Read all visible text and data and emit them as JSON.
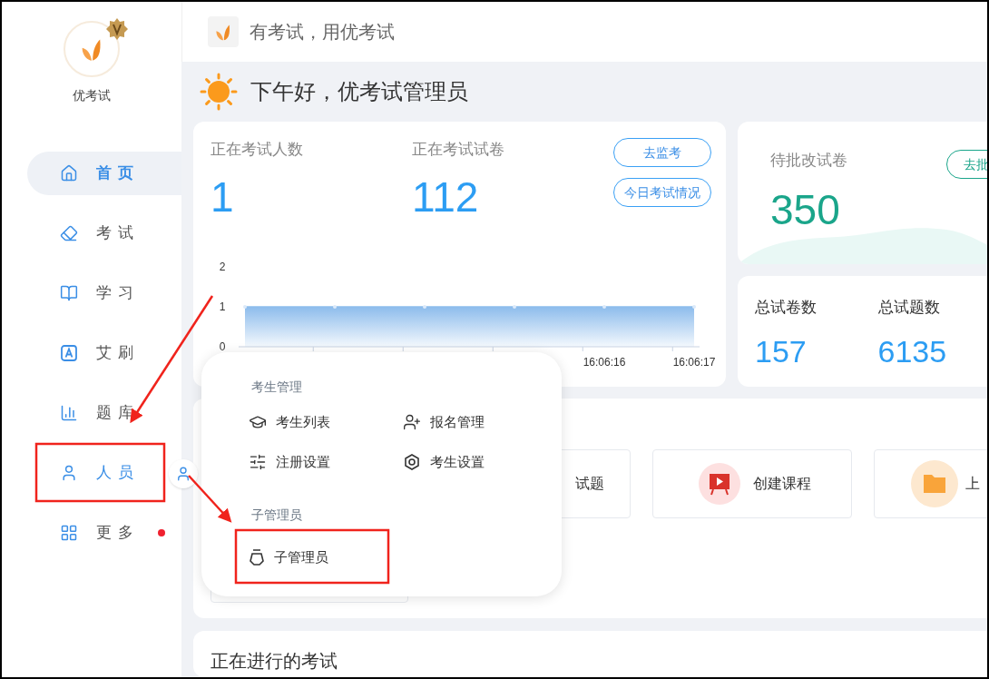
{
  "header": {
    "title": "有考试，用优考试"
  },
  "sidebar": {
    "brand": "优考试",
    "items": [
      {
        "label": "首页",
        "kind": "home",
        "selected": true,
        "expanded": false,
        "dot": false
      },
      {
        "label": "考试",
        "kind": "exam",
        "selected": false,
        "expanded": false,
        "dot": false
      },
      {
        "label": "学习",
        "kind": "study",
        "selected": false,
        "expanded": false,
        "dot": false
      },
      {
        "label": "艾刷",
        "kind": "practice",
        "selected": false,
        "expanded": false,
        "dot": false
      },
      {
        "label": "题库",
        "kind": "bank",
        "selected": false,
        "expanded": false,
        "dot": false
      },
      {
        "label": "人员",
        "kind": "people",
        "selected": false,
        "expanded": true,
        "dot": false
      },
      {
        "label": "更多",
        "kind": "more",
        "selected": false,
        "expanded": false,
        "dot": true
      }
    ]
  },
  "greeting": "下午好，优考试管理员",
  "live_card": {
    "stats": [
      {
        "label": "正在考试人数",
        "value": "1"
      },
      {
        "label": "正在考试试卷",
        "value": "112"
      }
    ],
    "buttons": [
      "去监考",
      "今日考试情况"
    ],
    "chart_data": {
      "type": "area",
      "categories": [
        null,
        null,
        null,
        null,
        "16:06:16",
        "16:06:17"
      ],
      "series": [
        {
          "color": "#8dbcec",
          "values": [
            1,
            1,
            1,
            1,
            1,
            1
          ]
        }
      ],
      "ylim": [
        0,
        2
      ],
      "yticks": [
        0,
        1,
        2
      ]
    }
  },
  "review_card": {
    "label": "待批改试卷",
    "value": "350",
    "button": "去批"
  },
  "totals_card": {
    "stats": [
      {
        "label": "总试卷数",
        "value": "157"
      },
      {
        "label": "总试题数",
        "value": "6135"
      }
    ]
  },
  "quick_actions": [
    {
      "label": "试题",
      "kind": "question"
    },
    {
      "label": "创建课程",
      "kind": "course"
    },
    {
      "label": "上",
      "kind": "upload"
    }
  ],
  "ongoing": {
    "title": "正在进行的考试"
  },
  "popup": {
    "sections": [
      {
        "title": "考生管理",
        "items": [
          {
            "label": "考生列表",
            "kind": "list"
          },
          {
            "label": "报名管理",
            "kind": "signup"
          },
          {
            "label": "注册设置",
            "kind": "register"
          },
          {
            "label": "考生设置",
            "kind": "settings"
          }
        ]
      },
      {
        "title": "子管理员",
        "items": [
          {
            "label": "子管理员",
            "kind": "subadmin"
          }
        ]
      }
    ]
  }
}
